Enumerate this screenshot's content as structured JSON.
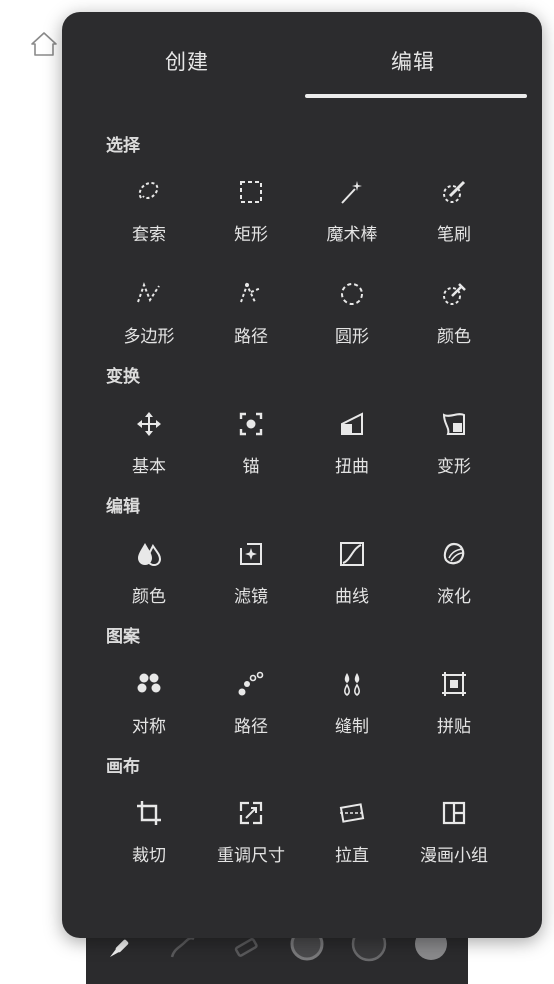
{
  "tabs": {
    "create": "创建",
    "edit": "编辑"
  },
  "sections": {
    "select": {
      "title": "选择",
      "tools": [
        "套索",
        "矩形",
        "魔术棒",
        "笔刷",
        "多边形",
        "路径",
        "圆形",
        "颜色"
      ]
    },
    "transform": {
      "title": "变换",
      "tools": [
        "基本",
        "锚",
        "扭曲",
        "变形"
      ]
    },
    "edit": {
      "title": "编辑",
      "tools": [
        "颜色",
        "滤镜",
        "曲线",
        "液化"
      ]
    },
    "pattern": {
      "title": "图案",
      "tools": [
        "对称",
        "路径",
        "缝制",
        "拼贴"
      ]
    },
    "canvas": {
      "title": "画布",
      "tools": [
        "裁切",
        "重调尺寸",
        "拉直",
        "漫画小组"
      ]
    }
  },
  "icons": {
    "home": "home-icon",
    "select": [
      "lasso-icon",
      "rect-select-icon",
      "magic-wand-icon",
      "brush-select-icon",
      "polygon-select-icon",
      "path-select-icon",
      "ellipse-select-icon",
      "color-select-icon"
    ],
    "transform": [
      "move-icon",
      "anchor-icon",
      "distort-icon",
      "warp-icon"
    ],
    "edit": [
      "color-drops-icon",
      "filter-icon",
      "curves-icon",
      "liquify-icon"
    ],
    "pattern": [
      "symmetry-icon",
      "pattern-path-icon",
      "stitch-icon",
      "tile-icon"
    ],
    "canvas": [
      "crop-icon",
      "resize-icon",
      "straighten-icon",
      "comic-panel-icon"
    ]
  },
  "colors": {
    "panel_bg": "#2c2c2e",
    "text": "#e4e4e4",
    "page_bg": "#ffffff"
  }
}
